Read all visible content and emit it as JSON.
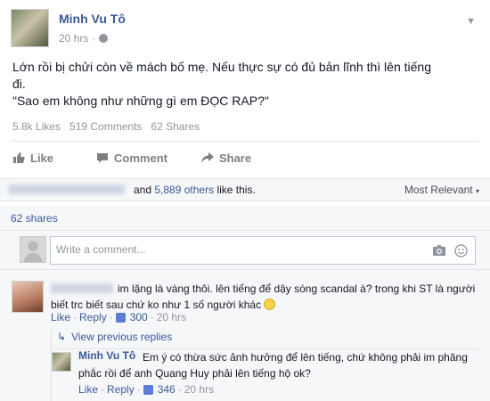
{
  "post": {
    "author": "Minh Vu Tô",
    "time": "20 hrs",
    "text_line1": "Lớn rồi bị chửi còn về mách bố mẹ. Nếu thực sự có đủ bản lĩnh thì lên tiếng",
    "text_line2": "đi.",
    "text_line3": "\"Sao em không như những gì em ĐỌC RAP?\"",
    "likes": "5.8k Likes",
    "comments": "519 Comments",
    "shares": "62 Shares"
  },
  "actions": {
    "like": "Like",
    "comment": "Comment",
    "share": "Share"
  },
  "likes_row": {
    "and": "and",
    "others_link": "5,889 others",
    "suffix": "like this.",
    "sort_label": "Most Relevant"
  },
  "shares_row": {
    "label": "62 shares"
  },
  "comment_box": {
    "placeholder": "Write a comment..."
  },
  "comment1": {
    "text": "im lặng là vàng thôi. lên tiếng để dậy sóng scandal à? trong khi ST là người biết trc biết sau chứ ko như 1 số người khác",
    "like": "Like",
    "reply": "Reply",
    "like_count": "300",
    "time": "20 hrs",
    "sep": "·"
  },
  "view_previous": "View previous replies",
  "reply1": {
    "author": "Minh Vu Tô",
    "text": "Em ý có thừa sức ảnh hưởng để lên tiếng, chứ không phải im phăng phắc rồi để anh Quang Huy phải lên tiếng hộ ok?",
    "like": "Like",
    "reply": "Reply",
    "like_count": "346",
    "time": "20 hrs",
    "sep": "·"
  },
  "colors": {
    "link": "#3b5998",
    "muted": "#90949c",
    "panel": "#f6f7f9"
  }
}
